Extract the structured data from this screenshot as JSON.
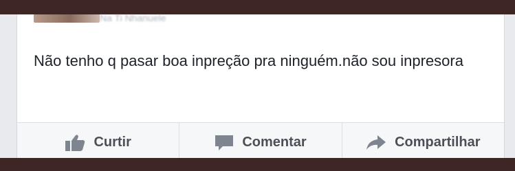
{
  "post": {
    "author_name": "Na Ti Nhanuele",
    "text": "Não tenho q pasar boa inpreção pra ninguém.não sou inpresora"
  },
  "actions": {
    "like_label": "Curtir",
    "comment_label": "Comentar",
    "share_label": "Compartilhar"
  },
  "icons": {
    "like": "thumbs-up-icon",
    "comment": "speech-bubble-icon",
    "share": "share-arrow-icon"
  },
  "colors": {
    "frame": "#3d2624",
    "card_background": "#ffffff",
    "text": "#1d2129",
    "action_text": "#4b4f56",
    "icon": "#7f8590"
  }
}
